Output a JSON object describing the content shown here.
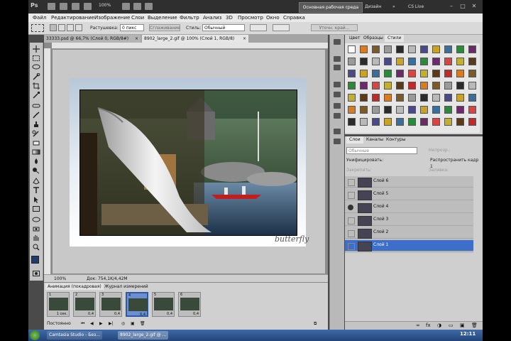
{
  "topbar": {
    "logo": "Ps",
    "zoom": "100%",
    "workspace_active": "Основная рабочая среда",
    "workspace_design": "Дизайн",
    "cs_live": "CS Live"
  },
  "menu": [
    "Файл",
    "Редактирование",
    "Изображение",
    "Слои",
    "Выделение",
    "Фильтр",
    "Анализ",
    "3D",
    "Просмотр",
    "Окно",
    "Справка"
  ],
  "options": {
    "feather_label": "Растушевка:",
    "feather_value": "0 пикс",
    "smoothing_label": "Сглаживание",
    "style_label": "Стиль:",
    "style_value": "Обычный",
    "refine_edge": "Уточн. край..."
  },
  "doc_tabs": [
    {
      "label": "33333.psd @ 66,7% (Слой 0, RGB/8#)",
      "close": "×"
    },
    {
      "label": "8902_large_2.gif @ 100% (Слой 1, RGB/8)",
      "close": "×"
    }
  ],
  "canvas": {
    "watermark": "butterfly",
    "zoom": "100%",
    "doc_info": "Док: 754,1K/4,42M"
  },
  "animation": {
    "tab_animation": "Анимация (покадровая)",
    "tab_log": "Журнал измерений",
    "loop": "Постоянно",
    "frames": [
      {
        "num": "1",
        "delay": "1 сек."
      },
      {
        "num": "2",
        "delay": "0,4"
      },
      {
        "num": "3",
        "delay": "0,4"
      },
      {
        "num": "4",
        "delay": "0,4"
      },
      {
        "num": "5",
        "delay": "0,4"
      },
      {
        "num": "6",
        "delay": "0,4"
      }
    ],
    "selected_frame": 4
  },
  "styles_panel": {
    "tabs": [
      "Цвет",
      "Образцы",
      "Стили"
    ],
    "active_tab": "Стили"
  },
  "layers_panel": {
    "tabs": [
      "Слои",
      "Каналы",
      "Контуры"
    ],
    "blend_mode": "Обычные",
    "opacity_label": "Непрозр.:",
    "unify_label": "Унифицировать:",
    "propagate_label": "Распространить кадр 1",
    "lock_label": "Закрепить:",
    "fill_label": "Заливка:",
    "layers": [
      {
        "name": "Слой 6",
        "visible": false,
        "selected": false
      },
      {
        "name": "Слой 5",
        "visible": false,
        "selected": false
      },
      {
        "name": "Слой 4",
        "visible": true,
        "selected": false
      },
      {
        "name": "Слой 3",
        "visible": false,
        "selected": false
      },
      {
        "name": "Слой 2",
        "visible": false,
        "selected": false
      },
      {
        "name": "Слой 1",
        "visible": false,
        "selected": true
      }
    ]
  },
  "taskbar": {
    "start": "",
    "tasks": [
      "Camtasia Studio - Без...",
      "8902_large_2.gif @ ..."
    ],
    "time": "12:11"
  },
  "colors": {
    "selection_blue": "#3d6ec9",
    "app_dark": "#2f2f2f"
  }
}
